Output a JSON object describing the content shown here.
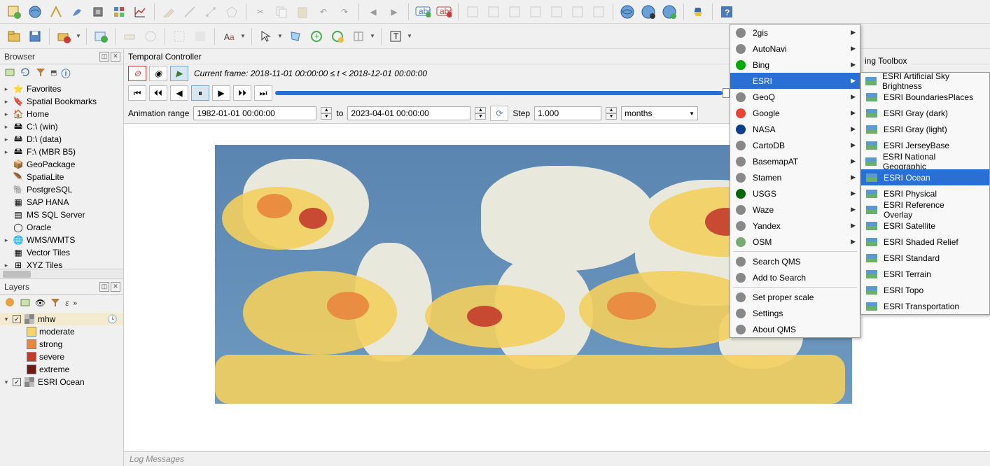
{
  "toolbar1_icons": [
    "new-project",
    "open-project",
    "vector",
    "feather",
    "chip",
    "grid",
    "chart",
    "pencil",
    "line",
    "nodes",
    "polygon",
    "scissors",
    "copy",
    "paste",
    "undo",
    "redo",
    "back",
    "forward",
    "label-add",
    "label-del",
    "m1",
    "m2",
    "m3",
    "m4",
    "m5",
    "m6",
    "m7",
    "globe-a",
    "globe-b",
    "globe-c",
    "python",
    "help"
  ],
  "toolbar2_icons": [
    "open",
    "save",
    "saveas",
    "layer-add",
    "layer-new",
    "layer-dup",
    "measure",
    "coord",
    "select",
    "deselect",
    "edit-poly",
    "node-edit",
    "add-ring",
    "del-ring",
    "split",
    "merge",
    "text"
  ],
  "browser": {
    "title": "Browser",
    "items": [
      {
        "expand": "▸",
        "icon": "star",
        "label": "Favorites"
      },
      {
        "expand": "▸",
        "icon": "bookmark",
        "label": "Spatial Bookmarks"
      },
      {
        "expand": "▸",
        "icon": "home",
        "label": "Home"
      },
      {
        "expand": "▸",
        "icon": "drive",
        "label": "C:\\ (win)"
      },
      {
        "expand": "▸",
        "icon": "drive",
        "label": "D:\\ (data)"
      },
      {
        "expand": "▸",
        "icon": "drive",
        "label": "F:\\ (MBR B5)"
      },
      {
        "expand": "",
        "icon": "geopackage",
        "label": "GeoPackage"
      },
      {
        "expand": "",
        "icon": "spatialite",
        "label": "SpatiaLite"
      },
      {
        "expand": "",
        "icon": "postgres",
        "label": "PostgreSQL"
      },
      {
        "expand": "",
        "icon": "saphana",
        "label": "SAP HANA"
      },
      {
        "expand": "",
        "icon": "mssql",
        "label": "MS SQL Server"
      },
      {
        "expand": "",
        "icon": "oracle",
        "label": "Oracle"
      },
      {
        "expand": "▸",
        "icon": "wms",
        "label": "WMS/WMTS"
      },
      {
        "expand": "",
        "icon": "vectortiles",
        "label": "Vector Tiles"
      },
      {
        "expand": "▸",
        "icon": "xyz",
        "label": "XYZ Tiles"
      }
    ]
  },
  "layers": {
    "title": "Layers",
    "groups": [
      {
        "checked": true,
        "name": "mhw",
        "icon": "raster",
        "clock": true,
        "children": [
          {
            "color": "#f6d36b",
            "label": "moderate"
          },
          {
            "color": "#e8863d",
            "label": "strong"
          },
          {
            "color": "#c33b2c",
            "label": "severe"
          },
          {
            "color": "#6e1a12",
            "label": "extreme"
          }
        ]
      },
      {
        "checked": true,
        "name": "ESRI Ocean",
        "icon": "raster-color",
        "children": []
      }
    ]
  },
  "temporal": {
    "title": "Temporal Controller",
    "frame_label": "Current frame: 2018-11-01 00:00:00 ≤ ",
    "frame_var": "t",
    "frame_tail": " < 2018-12-01 00:00:00",
    "range_label": "Animation range",
    "range_from": "1982-01-01 00:00:00",
    "to": "to",
    "range_to": "2023-04-01 00:00:00",
    "step_label": "Step",
    "step_value": "1.000",
    "step_unit": "months"
  },
  "log": "Log Messages",
  "processing_title": "ing Toolbox",
  "menu1": [
    {
      "icon": "2gis",
      "label": "2gis",
      "arrow": true
    },
    {
      "icon": "autonavi",
      "label": "AutoNavi",
      "arrow": true
    },
    {
      "icon": "bing",
      "label": "Bing",
      "arrow": true
    },
    {
      "icon": "esri",
      "label": "ESRI",
      "arrow": true,
      "selected": true
    },
    {
      "icon": "geoq",
      "label": "GeoQ",
      "arrow": true
    },
    {
      "icon": "google",
      "label": "Google",
      "arrow": true
    },
    {
      "icon": "nasa",
      "label": "NASA",
      "arrow": true
    },
    {
      "icon": "cartodb",
      "label": "CartoDB",
      "arrow": true
    },
    {
      "icon": "basemapat",
      "label": "BasemapAT",
      "arrow": true
    },
    {
      "icon": "stamen",
      "label": "Stamen",
      "arrow": true
    },
    {
      "icon": "usgs",
      "label": "USGS",
      "arrow": true
    },
    {
      "icon": "waze",
      "label": "Waze",
      "arrow": true
    },
    {
      "icon": "yandex",
      "label": "Yandex",
      "arrow": true
    },
    {
      "icon": "osm",
      "label": "OSM",
      "arrow": true
    },
    {
      "sep": true
    },
    {
      "icon": "search",
      "label": "Search QMS"
    },
    {
      "icon": "addsearch",
      "label": "Add to Search"
    },
    {
      "sep": true
    },
    {
      "icon": "scale",
      "label": "Set proper scale"
    },
    {
      "icon": "settings",
      "label": "Settings"
    },
    {
      "icon": "about",
      "label": "About QMS"
    }
  ],
  "menu2": [
    {
      "label": "ESRI Artificial Sky Brightness"
    },
    {
      "label": "ESRI BoundariesPlaces"
    },
    {
      "label": "ESRI Gray (dark)"
    },
    {
      "label": "ESRI Gray (light)"
    },
    {
      "label": "ESRI JerseyBase"
    },
    {
      "label": "ESRI National Geographic"
    },
    {
      "label": "ESRI Ocean",
      "selected": true
    },
    {
      "label": "ESRI Physical"
    },
    {
      "label": "ESRI Reference Overlay"
    },
    {
      "label": "ESRI Satellite"
    },
    {
      "label": "ESRI Shaded Relief"
    },
    {
      "label": "ESRI Standard"
    },
    {
      "label": "ESRI Terrain"
    },
    {
      "label": "ESRI Topo"
    },
    {
      "label": "ESRI Transportation"
    }
  ]
}
